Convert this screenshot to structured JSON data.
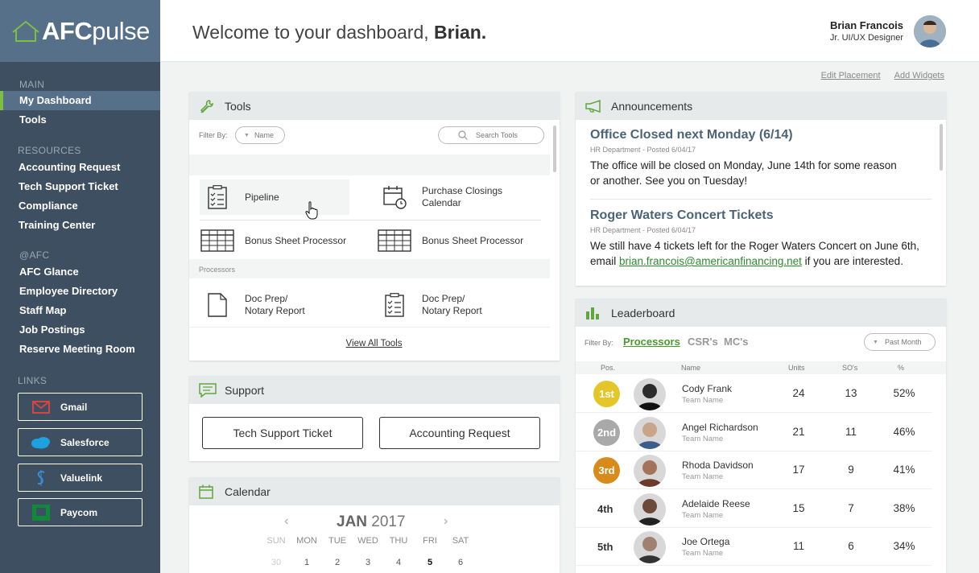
{
  "logo": {
    "brand_bold": "AFC",
    "brand_light": "pulse"
  },
  "sidebar": {
    "sections": {
      "main": "MAIN",
      "resources": "RESOURCES",
      "afc": "@AFC",
      "links": "LINKS"
    },
    "main_items": [
      "My Dashboard",
      "Tools"
    ],
    "resource_items": [
      "Accounting Request",
      "Tech Support Ticket",
      "Compliance",
      "Training Center"
    ],
    "afc_items": [
      "AFC Glance",
      "Employee Directory",
      "Staff Map",
      "Job Postings",
      "Reserve Meeting Room"
    ],
    "links": [
      {
        "label": "Gmail",
        "icon": "gmail-icon"
      },
      {
        "label": "Salesforce",
        "icon": "salesforce-icon"
      },
      {
        "label": "Valuelink",
        "icon": "valuelink-icon"
      },
      {
        "label": "Paycom",
        "icon": "paycom-icon"
      }
    ]
  },
  "header": {
    "welcome": "Welcome to your dashboard,",
    "welcome_name": "Brian.",
    "user_name": "Brian Francois",
    "user_role": "Jr. UI/UX Designer"
  },
  "top_links": {
    "edit": "Edit Placement",
    "add": "Add Widgets"
  },
  "tools": {
    "title": "Tools",
    "filter_label": "Filter By:",
    "filter_value": "Name",
    "search_placeholder": "Search Tools",
    "items": [
      {
        "label": "Pipeline",
        "icon": "checklist-icon"
      },
      {
        "label": "Purchase Closings Calendar",
        "icon": "calendar-clock-icon"
      },
      {
        "label": "Bonus Sheet Processor",
        "icon": "spreadsheet-icon"
      },
      {
        "label": "Bonus Sheet Processor",
        "icon": "spreadsheet-icon"
      }
    ],
    "processors_label": "Processors",
    "processor_items": [
      {
        "label": "Doc Prep/ Notary Report",
        "icon": "document-icon"
      },
      {
        "label": "Doc Prep/ Notary Report",
        "icon": "checklist-icon"
      }
    ],
    "view_all": "View All Tools"
  },
  "support": {
    "title": "Support",
    "buttons": [
      "Tech Support Ticket",
      "Accounting Request"
    ]
  },
  "calendar": {
    "title": "Calendar",
    "month": "JAN",
    "year": "2017",
    "days": [
      "SUN",
      "MON",
      "TUE",
      "WED",
      "THU",
      "FRI",
      "SAT"
    ],
    "first_row": [
      "30",
      "1",
      "2",
      "3",
      "4",
      "5",
      "6"
    ],
    "today": "5"
  },
  "announcements": {
    "title": "Announcements",
    "items": [
      {
        "title": "Office Closed next Monday (6/14)",
        "meta": "HR Department - Posted 6/04/17",
        "body_1": "The office will be closed on Monday, June 14th for some reason",
        "body_2": "or another.  See you on Tuesday!"
      },
      {
        "title": "Roger Waters Concert Tickets",
        "meta": "HR Department - Posted 6/04/17",
        "body_1": "We still have 4 tickets left for the Roger Waters Concert on June 6th,",
        "body_2_pre": "email",
        "email": "brian.francois@americanfinancing.net",
        "body_2_post": "if you are interested."
      }
    ]
  },
  "leaderboard": {
    "title": "Leaderboard",
    "filter_label": "Filter By:",
    "tabs": [
      "Processors",
      "CSR's",
      "MC's"
    ],
    "period": "Past Month",
    "columns": [
      "Pos.",
      "Name",
      "Units",
      "SO's",
      "%"
    ],
    "rows": [
      {
        "pos": "1st",
        "name": "Cody Frank",
        "team": "Team Name",
        "units": "24",
        "sos": "13",
        "pct": "52%",
        "color": "#e4c52a"
      },
      {
        "pos": "2nd",
        "name": "Angel Richardson",
        "team": "Team Name",
        "units": "21",
        "sos": "11",
        "pct": "46%",
        "color": "#a9a9a9"
      },
      {
        "pos": "3rd",
        "name": "Rhoda Davidson",
        "team": "Team Name",
        "units": "17",
        "sos": "9",
        "pct": "41%",
        "color": "#d88a1a"
      },
      {
        "pos": "4th",
        "name": "Adelaide Reese",
        "team": "Team Name",
        "units": "15",
        "sos": "7",
        "pct": "38%",
        "color": ""
      },
      {
        "pos": "5th",
        "name": "Joe Ortega",
        "team": "Team Name",
        "units": "11",
        "sos": "6",
        "pct": "34%",
        "color": ""
      }
    ]
  },
  "colors": {
    "accent_green": "#7bbf43",
    "link_green": "#2e8a2e",
    "sidebar": "#3d4f60",
    "logo_bg": "#56708a"
  }
}
